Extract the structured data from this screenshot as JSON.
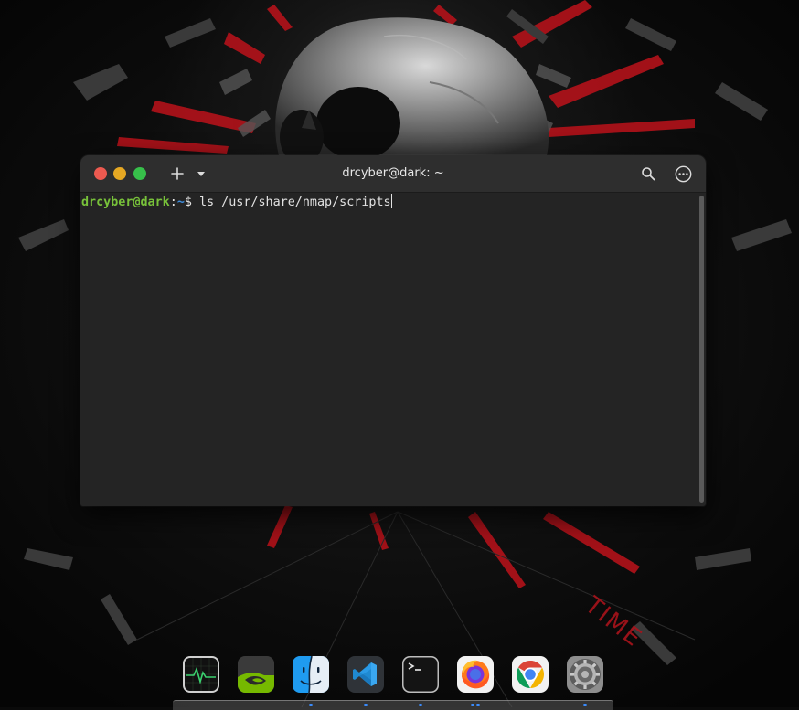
{
  "window": {
    "title": "drcyber@dark: ~",
    "buttons": {
      "close": "close",
      "minimize": "minimize",
      "maximize": "maximize",
      "new_tab": "plus-icon",
      "tab_menu": "chevron-down-icon",
      "search": "search-icon",
      "menu": "ellipsis-icon"
    }
  },
  "terminal": {
    "user_host": "drcyber@dark",
    "separator": ":",
    "cwd": "~",
    "prompt_symbol": "$ ",
    "command": "ls /usr/share/nmap/scripts",
    "colors": {
      "user_host": "#78c23a",
      "cwd": "#3f8fe0",
      "background": "#242424",
      "text": "#e2e2e2"
    }
  },
  "wallpaper": {
    "word": "TIME",
    "accent": "#c0141d"
  },
  "dock": {
    "items": [
      {
        "name": "activity-monitor",
        "icon": "activity-monitor-icon",
        "running": false
      },
      {
        "name": "nvidia-settings",
        "icon": "nvidia-icon",
        "running": false
      },
      {
        "name": "finder",
        "icon": "finder-icon",
        "running": true
      },
      {
        "name": "visual-studio-code",
        "icon": "vscode-icon",
        "running": true
      },
      {
        "name": "terminal",
        "icon": "terminal-icon",
        "running": true
      },
      {
        "name": "firefox",
        "icon": "firefox-icon",
        "running": true
      },
      {
        "name": "chrome",
        "icon": "chrome-icon",
        "running": false
      },
      {
        "name": "system-settings",
        "icon": "settings-gear-icon",
        "running": true
      }
    ]
  }
}
